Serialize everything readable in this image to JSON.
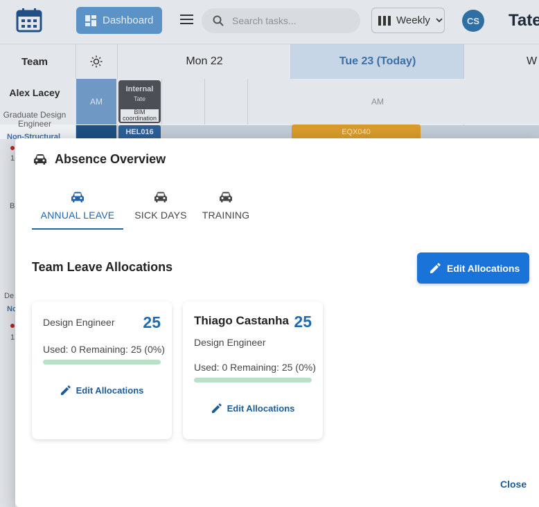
{
  "header": {
    "dashboard_label": "Dashboard",
    "search_placeholder": "Search tasks...",
    "view_label": "Weekly",
    "avatar_initials": "CS",
    "brand": "Tate"
  },
  "grid": {
    "team_header": "Team",
    "days": [
      "Mon 22",
      "Tue 23 (Today)",
      "W"
    ],
    "person": {
      "name": "Alex Lacey",
      "role": "Graduate Design Engineer",
      "discipline": "Non-Structural"
    },
    "am_label": "AM",
    "am_label_right": "AM",
    "internal_title": "Internal",
    "internal_sub": "Tate",
    "internal_task": "BIM coordination",
    "hel_code": "HEL016",
    "eqx_code": "EQX040",
    "left_strip_text": [
      "1",
      "B",
      "De",
      "No",
      "1"
    ]
  },
  "modal": {
    "title": "Absence Overview",
    "tabs": [
      {
        "label": "ANNUAL LEAVE",
        "icon": "car-icon",
        "active": true
      },
      {
        "label": "SICK DAYS",
        "icon": "car-icon",
        "active": false
      },
      {
        "label": "TRAINING",
        "icon": "car-icon",
        "active": false
      }
    ],
    "section_title": "Team Leave Allocations",
    "edit_allocations_label": "Edit Allocations",
    "cards": [
      {
        "name": "",
        "role": "Design Engineer",
        "allocation": "25",
        "usage": "Used: 0 Remaining: 25 (0%)",
        "used_fraction": 0.0,
        "edit_label": "Edit Allocations"
      },
      {
        "name": "Thiago Castanha",
        "role": "Design Engineer",
        "allocation": "25",
        "usage": "Used: 0 Remaining: 25 (0%)",
        "used_fraction": 0.0,
        "edit_label": "Edit Allocations"
      }
    ],
    "close_label": "Close"
  },
  "colors": {
    "accent": "#1a73d9",
    "brand_blue": "#1f6bae",
    "progress_track": "#b9e0c8"
  }
}
